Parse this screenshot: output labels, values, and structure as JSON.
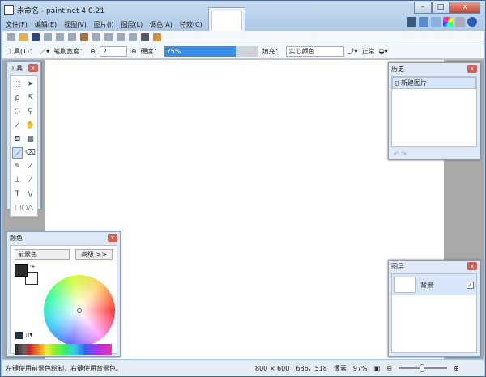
{
  "window": {
    "title": "未命名 - paint.net 4.0.21",
    "min": "–",
    "max": "□",
    "close": "x"
  },
  "menu": [
    "文件(F)",
    "编辑(E)",
    "视图(V)",
    "图片(I)",
    "图层(L)",
    "调色(A)",
    "特效(C)"
  ],
  "toolbar": {
    "tool_label": "工具(T)：",
    "brush_width_label": "笔刷宽度：",
    "brush_width": "2",
    "hardness_label": "硬度：",
    "hardness": "75%",
    "hardness_value": 0.75,
    "fill_label": "填充：",
    "fill_value": "实心颜色",
    "blend_mode": "正常"
  },
  "tools_panel": {
    "title": "工具"
  },
  "colors_panel": {
    "title": "颜色",
    "mode": "前景色",
    "more_button": "高级 >>",
    "primary_color": "#2b2b2b",
    "secondary_color": "#ffffff"
  },
  "history_panel": {
    "title": "历史",
    "items": [
      "新建图片"
    ]
  },
  "layers_panel": {
    "title": "图层",
    "layers": [
      {
        "name": "背景",
        "visible": true
      }
    ]
  },
  "status": {
    "hint": "左键使用前景色绘制，右键使用背景色。",
    "image_size": "800 × 600",
    "cursor": "686，518",
    "units": "像素",
    "zoom": "97%"
  }
}
